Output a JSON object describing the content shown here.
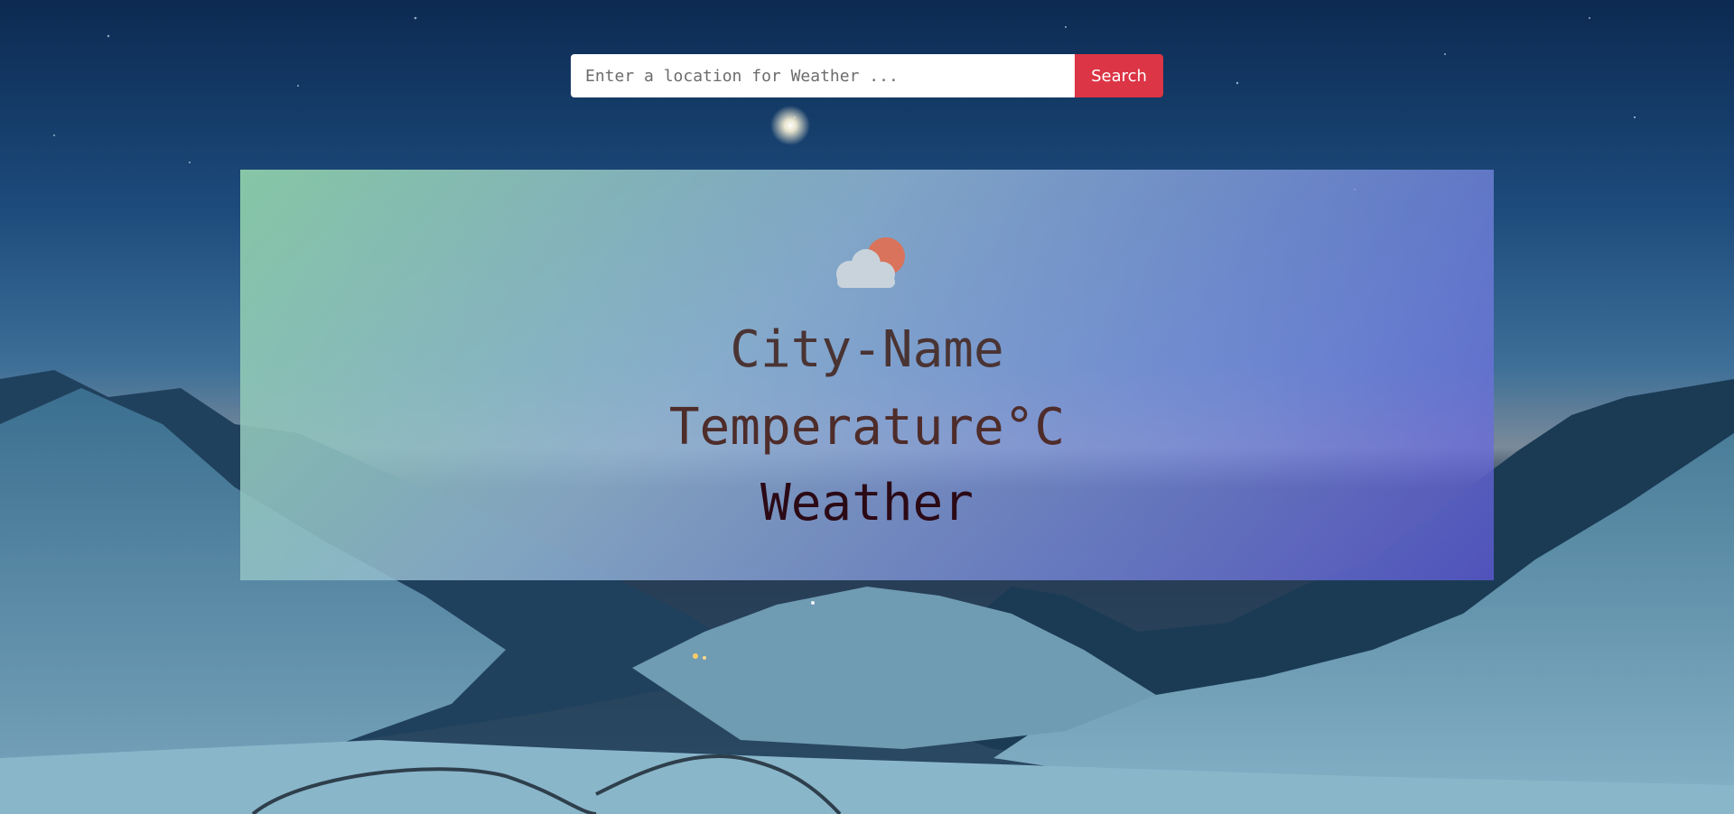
{
  "search": {
    "placeholder": "Enter a location for Weather ...",
    "value": "",
    "button_label": "Search"
  },
  "weather": {
    "icon": "partly-cloudy-icon",
    "city": "City-Name",
    "temperature": "Temperature°C",
    "condition": "Weather"
  },
  "colors": {
    "search_button": "#dc3545",
    "sun": "#d9735b",
    "cloud": "#c9d3dc"
  }
}
